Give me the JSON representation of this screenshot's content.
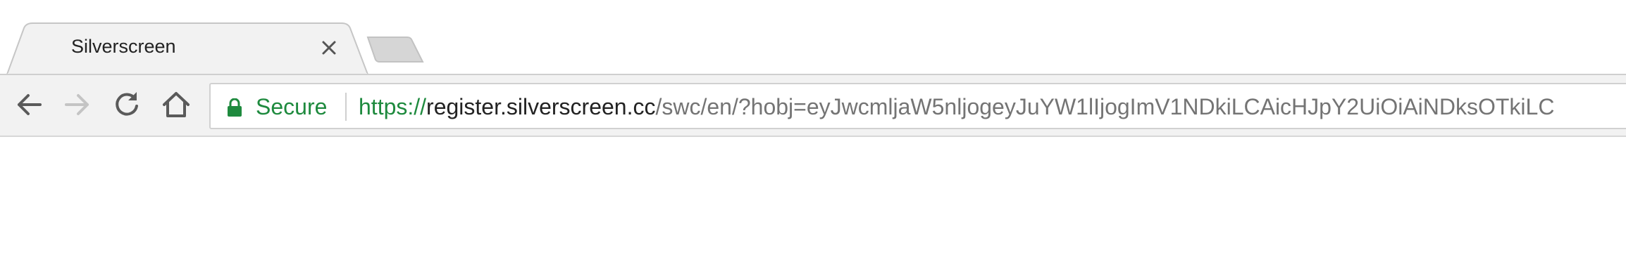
{
  "tab": {
    "title": "Silverscreen",
    "close_icon": "close-icon"
  },
  "new_tab": {
    "icon": "new-tab-icon"
  },
  "toolbar": {
    "back_icon": "arrow-left-icon",
    "forward_icon": "arrow-right-icon",
    "reload_icon": "reload-icon",
    "home_icon": "home-icon"
  },
  "omnibox": {
    "lock_icon": "lock-icon",
    "secure_label": "Secure",
    "url_scheme": "https://",
    "url_host": "register.silverscreen.cc",
    "url_path": "/swc/en/?hobj=eyJwcmljaW5nljogeyJuYW1lIjogImV1NDkiLCAicHJpY2UiOiAiNDksOTkiLC"
  },
  "colors": {
    "secure_green": "#1e8a3e",
    "toolbar_bg": "#f2f2f2",
    "tab_bg": "#f2f2f2"
  }
}
